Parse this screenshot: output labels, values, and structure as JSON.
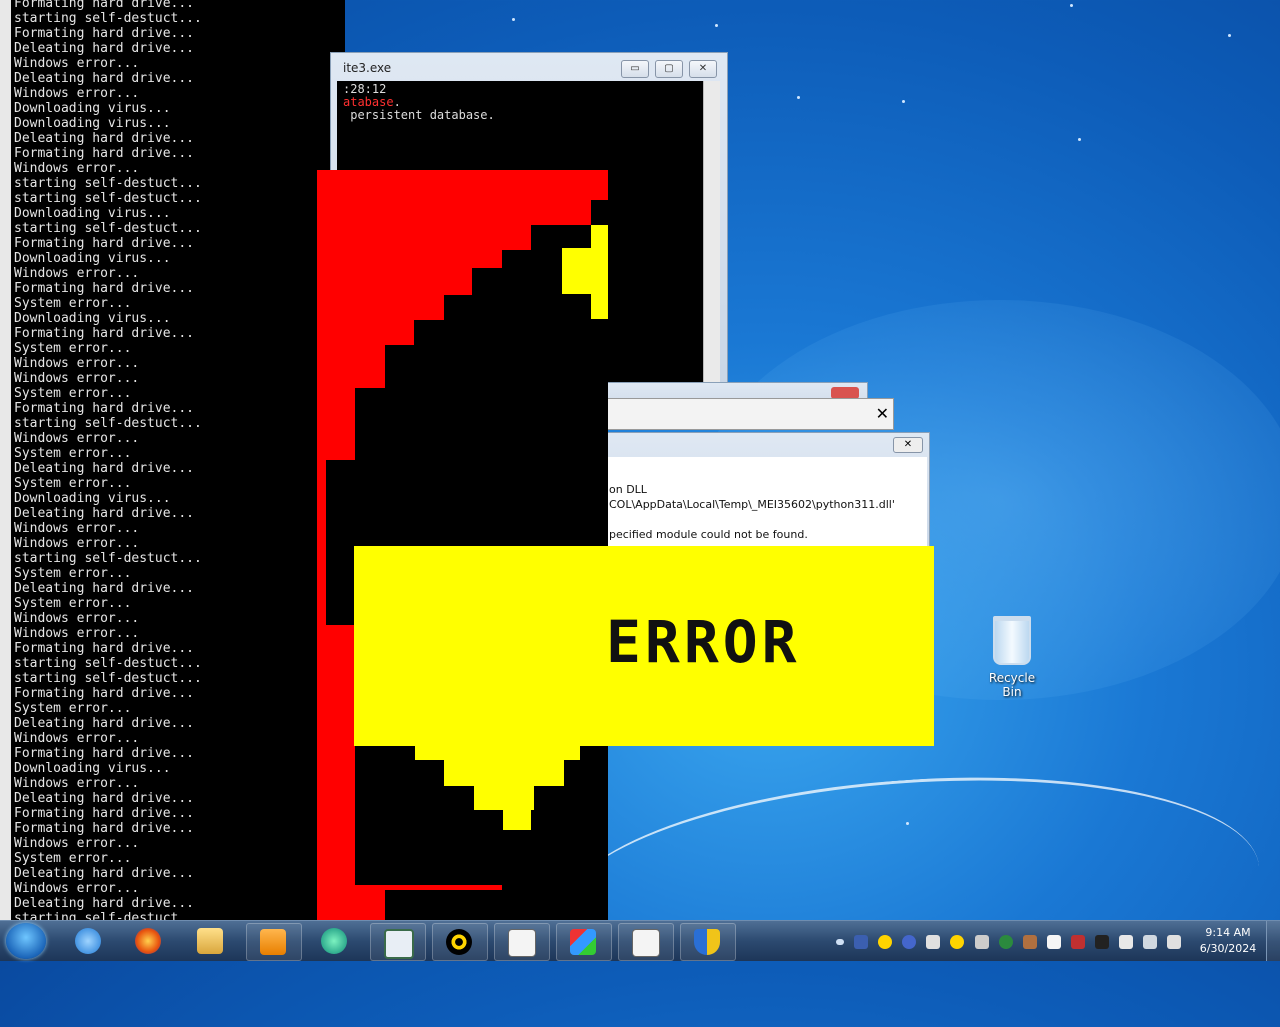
{
  "console_left": {
    "lines": [
      "Formating hard drive...",
      "starting self-destuct...",
      "Formating hard drive...",
      "Deleating hard drive...",
      "Windows error...",
      "Deleating hard drive...",
      "Windows error...",
      "Downloading virus...",
      "Downloading virus...",
      "Deleating hard drive...",
      "Formating hard drive...",
      "Windows error...",
      "starting self-destuct...",
      "starting self-destuct...",
      "Downloading virus...",
      "starting self-destuct...",
      "Formating hard drive...",
      "Downloading virus...",
      "Windows error...",
      "Formating hard drive...",
      "System error...",
      "Downloading virus...",
      "Formating hard drive...",
      "System error...",
      "Windows error...",
      "Windows error...",
      "System error...",
      "Formating hard drive...",
      "starting self-destuct...",
      "Windows error...",
      "System error...",
      "Deleating hard drive...",
      "System error...",
      "Downloading virus...",
      "Deleating hard drive...",
      "Windows error...",
      "Windows error...",
      "starting self-destuct...",
      "System error...",
      "Deleating hard drive...",
      "System error...",
      "Windows error...",
      "Windows error...",
      "Formating hard drive...",
      "starting self-destuct...",
      "starting self-destuct...",
      "Formating hard drive...",
      "System error...",
      "Deleating hard drive...",
      "Windows error...",
      "Formating hard drive...",
      "Downloading virus...",
      "Windows error...",
      "Deleating hard drive...",
      "Formating hard drive...",
      "Formating hard drive...",
      "Windows error...",
      "System error...",
      "Deleating hard drive...",
      "Windows error...",
      "Deleating hard drive...",
      "starting self-destuct..."
    ]
  },
  "sqlite_window": {
    "title": "ite3.exe",
    "line1": ":28:12",
    "line2_red": "atabase",
    "line2_tail": ".",
    "line3": " persistent database.",
    "minimize": "▭",
    "maximize": "▢",
    "close": "✕"
  },
  "dialog_close": {
    "close_glyph": "✕"
  },
  "dialog_error": {
    "close_glyph": "✕",
    "line1": "on DLL",
    "line2": "COL\\AppData\\Local\\Temp\\_MEI35602\\python311.dll'",
    "line3": "pecified module could not be found."
  },
  "banner": {
    "text": "ERROR"
  },
  "desktop": {
    "recycle_bin_label": "Recycle Bin"
  },
  "taskbar": {
    "items": [
      "internet-explorer-icon",
      "firefox-icon",
      "file-explorer-icon",
      "media-player-icon",
      "browser-icon",
      "window-icon",
      "radiation-icon",
      "document-icon",
      "installer-icon",
      "document-icon",
      "shield-icon"
    ],
    "time": "9:14 AM",
    "date": "6/30/2024"
  },
  "colors": {
    "red": "#ff0000",
    "yellow": "#ffff00",
    "black": "#000000"
  }
}
